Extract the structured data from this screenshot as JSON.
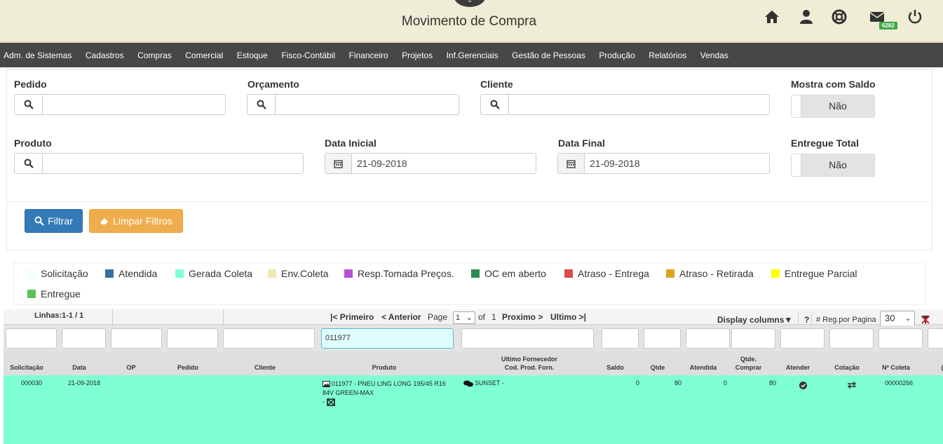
{
  "header": {
    "title": "Movimento de Compra",
    "mail_count": "6282",
    "icons": [
      "home-icon",
      "user-icon",
      "help-icon",
      "mail-icon",
      "power-icon"
    ]
  },
  "menu": [
    "Adm. de Sistemas",
    "Cadastros",
    "Compras",
    "Comercial",
    "Estoque",
    "Fisco-Contábil",
    "Financeiro",
    "Projetos",
    "Inf.Gerenciais",
    "Gestão de Pessoas",
    "Produção",
    "Relatórios",
    "Vendas"
  ],
  "filters": {
    "pedido_label": "Pedido",
    "orcamento_label": "Orçamento",
    "cliente_label": "Cliente",
    "mostra_saldo_label": "Mostra com Saldo",
    "mostra_saldo_value": "Não",
    "produto_label": "Produto",
    "data_inicial_label": "Data Inicial",
    "data_inicial_value": "21-09-2018",
    "data_final_label": "Data Final",
    "data_final_value": "21-09-2018",
    "entregue_total_label": "Entregue Total",
    "entregue_total_value": "Não",
    "filtrar_label": "Filtrar",
    "limpar_label": "Limpar Filtros"
  },
  "legend": [
    {
      "label": "Solicitação",
      "color": "#f0ffff"
    },
    {
      "label": "Atendida",
      "color": "#3a6ea5"
    },
    {
      "label": "Gerada Coleta",
      "color": "#7fffd4"
    },
    {
      "label": "Env.Coleta",
      "color": "#efe8b2"
    },
    {
      "label": "Resp.Tomada Preços.",
      "color": "#b84fd8"
    },
    {
      "label": "OC em aberto",
      "color": "#2e8b57"
    },
    {
      "label": "Atraso - Entrega",
      "color": "#dd4b4b"
    },
    {
      "label": "Atraso - Retirada",
      "color": "#daa520"
    },
    {
      "label": "Entregue Parcial",
      "color": "#ffff00"
    },
    {
      "label": "Entregue",
      "color": "#5cc15c"
    }
  ],
  "pager": {
    "linhas": "Linhas:1-1 / 1",
    "primeiro": "|< Primeiro",
    "anterior": "< Anterior",
    "page_label": "Page",
    "page_value": "1",
    "of_label": "of",
    "total_pages": "1",
    "proximo": "Proximo >",
    "ultimo": "Ultimo >|",
    "display_columns": "Display columns▼",
    "help": "?",
    "reg_label": "# Reg.por Pagina",
    "reg_value": "30"
  },
  "search": {
    "produto": "011977"
  },
  "columns": {
    "solicitacao": "Solicitação",
    "data": "Data",
    "op": "OP",
    "pedido": "Pedido",
    "cliente": "Cliente",
    "produto": "Produto",
    "fornecedor_1": "Ultimo Fornecedor",
    "fornecedor_2": "Cod. Prod. Forn.",
    "saldo": "Saldo",
    "qtde": "Qtde",
    "atendida": "Atendida",
    "qtde_comprar_1": "Qtde.",
    "qtde_comprar_2": "Comprar",
    "atender": "Atender",
    "cotacao": "Cotação",
    "coleta": "Nº Coleta"
  },
  "rows": [
    {
      "solicitacao": "000030",
      "data": "21-09-2018",
      "produto_1": "011977 - PNEU LING LONG 195/45 R16",
      "produto_2": "84V GREEN-MAX",
      "produto_3": "-",
      "fornecedor": "SUNSET -",
      "saldo": "0",
      "qtde": "80",
      "atendida": "0",
      "qtde_comprar": "80",
      "coleta": "00000266"
    }
  ]
}
